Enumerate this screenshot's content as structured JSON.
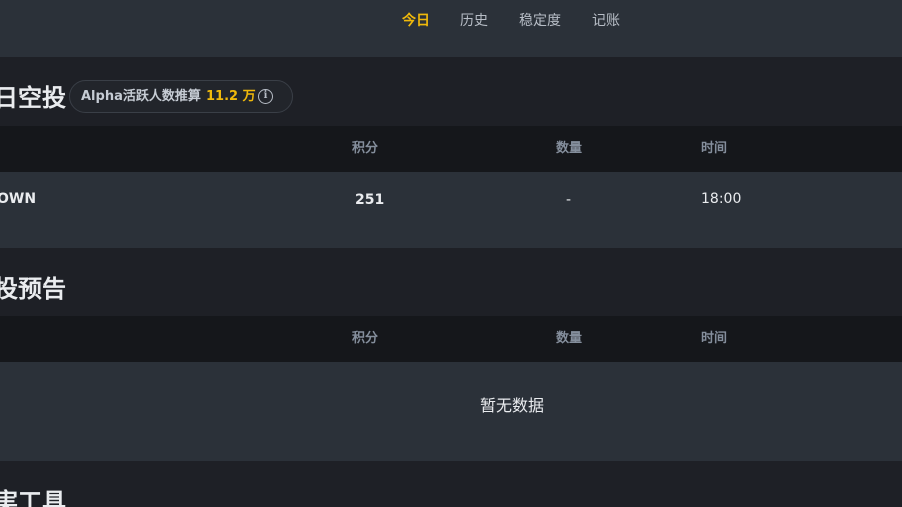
{
  "nav": {
    "tabs": [
      {
        "label": "今日",
        "active": true
      },
      {
        "label": "历史",
        "active": false
      },
      {
        "label": "稳定度",
        "active": false
      },
      {
        "label": "记账",
        "active": false
      }
    ]
  },
  "today_airdrop": {
    "title": "日空投",
    "badge": {
      "label": "Alpha活跃人数推算",
      "value": "11.2 万",
      "icon": "info-icon"
    },
    "columns": [
      "积分",
      "数量",
      "时间"
    ],
    "rows": [
      {
        "token": "OWN",
        "points": "251",
        "quantity": "-",
        "time": "18:00"
      }
    ]
  },
  "airdrop_preview": {
    "title": "投预告",
    "columns": [
      "积分",
      "数量",
      "时间"
    ],
    "empty_text": "暂无数据"
  },
  "tools": {
    "title": "実工具"
  },
  "colors": {
    "accent": "#f0b90b",
    "nav_bg": "#2b3139",
    "page_bg": "#1e2026",
    "table_header_bg": "#15171b",
    "row_bg": "#2b3139"
  }
}
